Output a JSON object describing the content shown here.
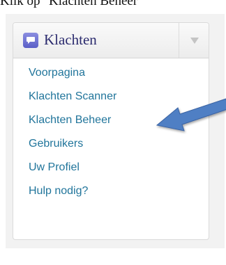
{
  "caption": "Klik op \"Klachten Beheer\"",
  "menu": {
    "title": "Klachten",
    "icon": "speech-bubble-icon",
    "toggle_icon": "triangle-down-icon",
    "items": [
      {
        "label": "Voorpagina"
      },
      {
        "label": "Klachten Scanner"
      },
      {
        "label": "Klachten Beheer"
      },
      {
        "label": "Gebruikers"
      },
      {
        "label": "Uw Profiel"
      },
      {
        "label": "Hulp nodig?"
      }
    ]
  },
  "annotation": {
    "icon": "arrow-pointer-icon",
    "color": "#4f7fc4"
  },
  "colors": {
    "link": "#21759b",
    "title": "#2b2b6e",
    "icon_bg": "#6f73d6"
  }
}
